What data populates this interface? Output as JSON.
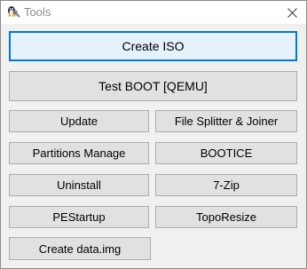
{
  "window": {
    "title": "Tools",
    "close_glyph": "close-icon",
    "app_icon": "tux-wrench-icon"
  },
  "buttons": {
    "create_iso": "Create ISO",
    "test_boot": "Test BOOT [QEMU]",
    "update": "Update",
    "file_splitter": "File Splitter & Joiner",
    "partitions_manage": "Partitions Manage",
    "bootice": "BOOTICE",
    "uninstall": "Uninstall",
    "seven_zip": "7-Zip",
    "pestartup": "PEStartup",
    "toporesize": "TopoResize",
    "create_data_img": "Create data.img"
  },
  "colors": {
    "focus_border": "#0078d7",
    "button_face": "#e1e1e1",
    "button_border": "#adadad",
    "window_bg": "#f0f0f0"
  }
}
